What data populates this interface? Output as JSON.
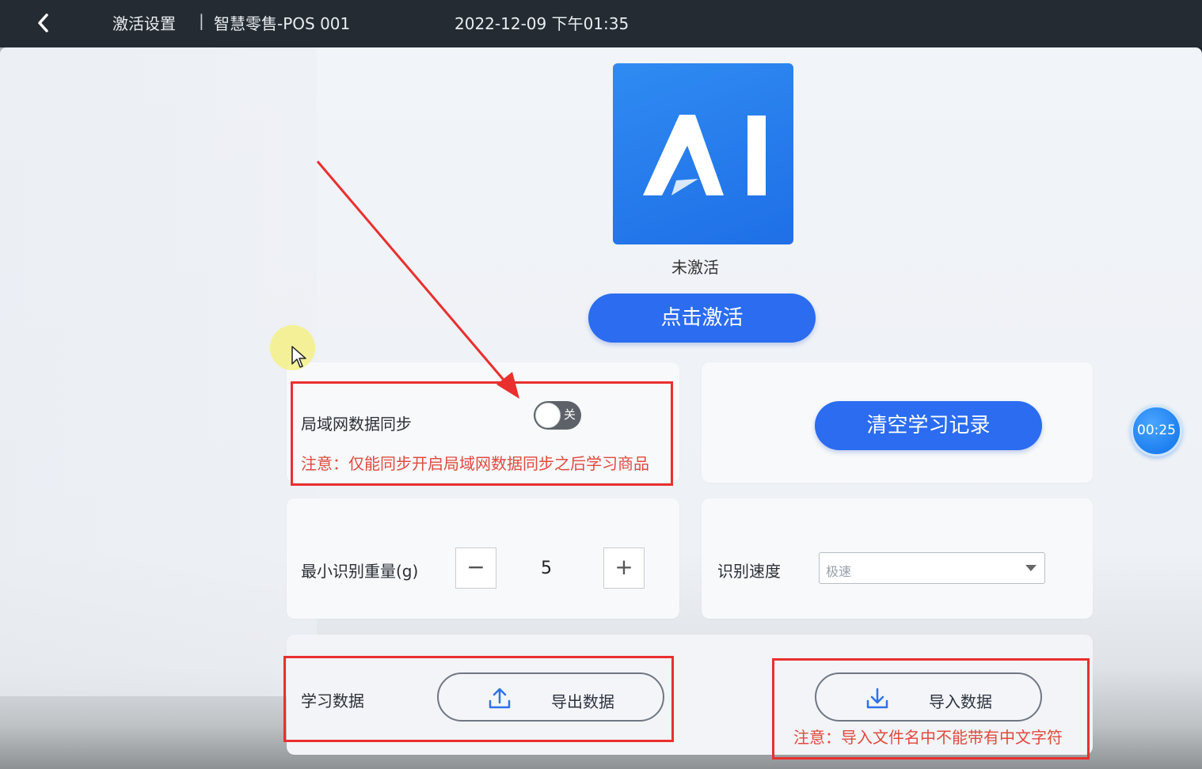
{
  "topbar": {
    "title": "激活设置",
    "separator": "|",
    "device": "智慧零售-POS 001",
    "datetime": "2022-12-09 下午01:35"
  },
  "activation": {
    "logo_text": "AI",
    "status": "未激活",
    "activate_label": "点击激活"
  },
  "lan_sync": {
    "label": "局域网数据同步",
    "toggle_state_text": "关",
    "toggle_on": false,
    "warning": "注意：仅能同步开启局域网数据同步之后学习商品"
  },
  "clear_learning": {
    "label": "清空学习记录"
  },
  "min_weight": {
    "label": "最小识别重量(g)",
    "minus": "−",
    "plus": "+",
    "value": "5"
  },
  "speed": {
    "label": "识别速度",
    "selected": "极速"
  },
  "learn_data": {
    "label": "学习数据",
    "export_label": "导出数据",
    "import_label": "导入数据",
    "import_warning": "注意：导入文件名中不能带有中文字符"
  },
  "recording_timer": "00:25",
  "colors": {
    "topbar_bg": "#252b33",
    "primary": "#2b6cf0",
    "warning": "#e04a3f",
    "annotation": "#ea2f2f"
  },
  "icons": {
    "back": "chevron-left-icon",
    "export": "upload-icon",
    "import": "download-icon",
    "cursor": "mouse-pointer-icon"
  }
}
